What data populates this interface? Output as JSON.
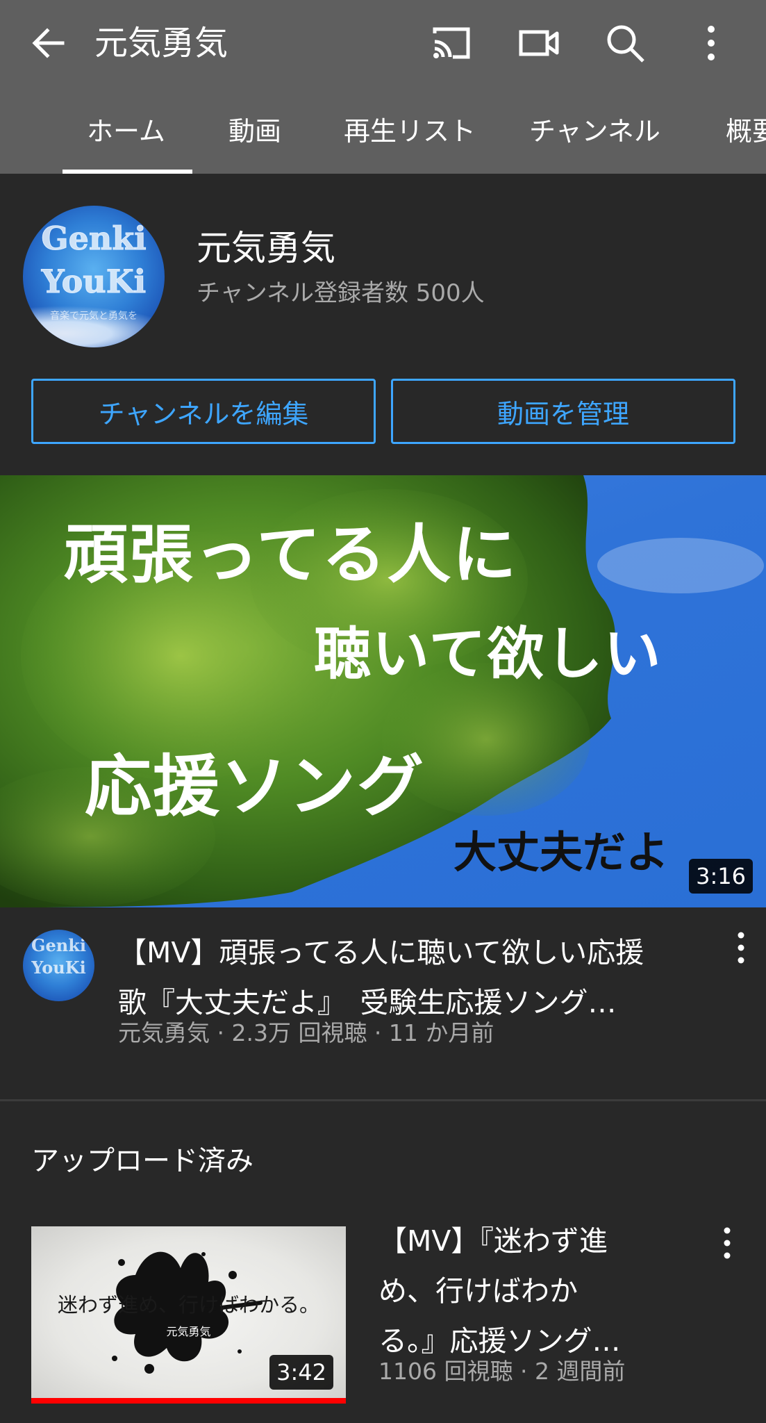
{
  "appbar": {
    "title": "元気勇気",
    "icons": [
      "back-arrow-icon",
      "cast-icon",
      "video-camera-icon",
      "search-icon",
      "more-vert-icon"
    ]
  },
  "tabs": [
    {
      "label": "ホーム",
      "selected": true
    },
    {
      "label": "動画",
      "selected": false
    },
    {
      "label": "再生リスト",
      "selected": false
    },
    {
      "label": "チャンネル",
      "selected": false
    },
    {
      "label": "概要",
      "selected": false
    }
  ],
  "channel": {
    "name": "元気勇気",
    "subscribers": "チャンネル登録者数 500人",
    "avatar_text": {
      "line1": "Genki",
      "line2": "YouKi",
      "tagline": "音楽で元気と勇気を"
    },
    "edit_button": "チャンネルを編集",
    "manage_button": "動画を管理"
  },
  "featured": {
    "thumb_text": {
      "line1": "頑張ってる人に",
      "line2": "聴いて欲しい",
      "line3": "応援ソング",
      "line4": "大丈夫だよ"
    },
    "duration": "3:16",
    "title_line1": "【MV】頑張ってる人に聴いて欲しい応援",
    "title_line2": "歌『大丈夫だよ』　受験生応援ソング…",
    "meta": "元気勇気 · 2.3万 回視聴 · 11 か月前"
  },
  "uploads": {
    "section_title": "アップロード済み",
    "items": [
      {
        "thumb_text": "迷わず進め、行けばわかる。",
        "thumb_sub": "元気勇気",
        "duration": "3:42",
        "watched_fraction": 1.0,
        "title_line1": "【MV】『迷わず進",
        "title_line2": "め、行けばわか",
        "title_line3": "る。』応援ソング…",
        "meta": "1106 回視聴 · 2 週間前"
      }
    ]
  },
  "colors": {
    "appbar_bg": "#5f5f5f",
    "page_bg": "#282828",
    "accent_blue": "#3ea6ff",
    "secondary_text": "#aaaaaa",
    "progress_red": "#ff0000"
  }
}
